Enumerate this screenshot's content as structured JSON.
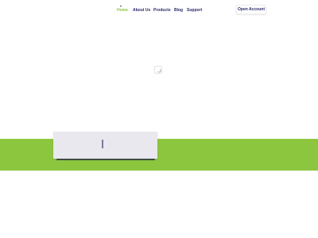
{
  "nav": {
    "items": [
      {
        "label": "Home",
        "active": true
      },
      {
        "label": "About Us",
        "active": false
      },
      {
        "label": "Products",
        "active": false
      },
      {
        "label": "Blog",
        "active": false
      },
      {
        "label": "Support",
        "active": false
      }
    ],
    "cta_label": "Open Account"
  },
  "colors": {
    "brand_green": "#8cc63f",
    "nav_text": "#2c2a6b",
    "card_bg": "#e9e8ee"
  },
  "icons": {
    "dropdown": "chevron-down-icon",
    "loader": "spinner-icon"
  }
}
